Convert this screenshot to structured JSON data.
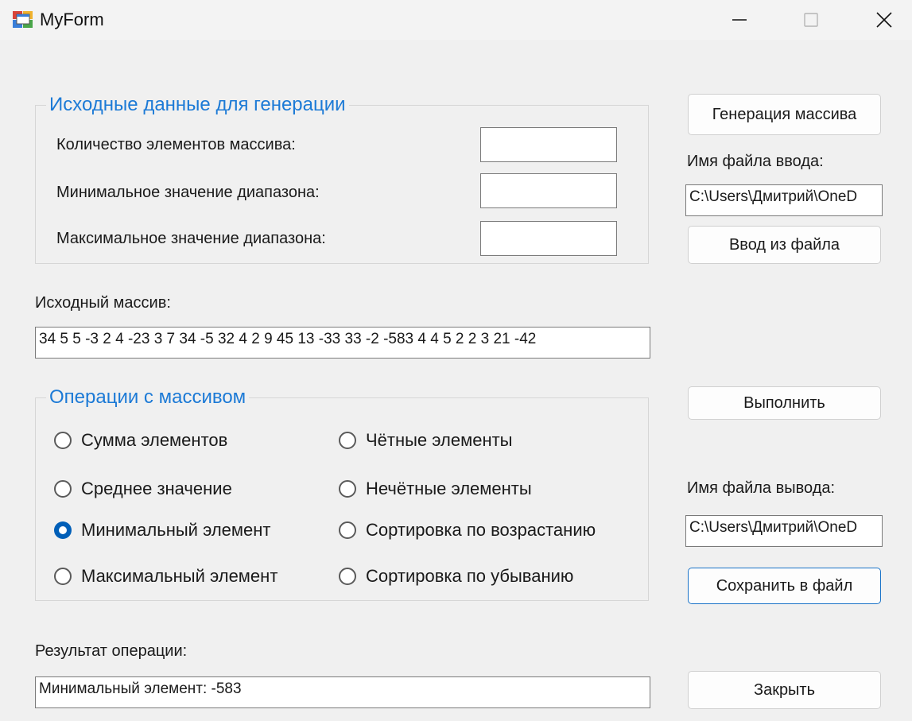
{
  "window": {
    "title": "MyForm"
  },
  "generation_group": {
    "title": "Исходные данные для генерации",
    "count_label": "Количество элементов массива:",
    "count_value": "",
    "min_label": "Минимальное значение диапазона:",
    "min_value": "",
    "max_label": "Максимальное значение диапазона:",
    "max_value": ""
  },
  "buttons": {
    "generate": "Генерация массива",
    "load_from_file": "Ввод из файла",
    "execute": "Выполнить",
    "save_to_file": "Сохранить в файл",
    "close": "Закрыть"
  },
  "input_file": {
    "label": "Имя файла ввода:",
    "value": "C:\\Users\\Дмитрий\\OneD"
  },
  "output_file": {
    "label": "Имя файла вывода:",
    "value": "C:\\Users\\Дмитрий\\OneD"
  },
  "source_array": {
    "label": "Исходный массив:",
    "value": "34 5 5 -3 2 4 -23 3 7 34 -5 32 4 2 9 45 13 -33 33 -2 -583 4 4 5 2 2 3 21 -42"
  },
  "operations_group": {
    "title": "Операции с массивом",
    "options": [
      {
        "label": "Сумма элементов",
        "checked": false
      },
      {
        "label": "Среднее значение",
        "checked": false
      },
      {
        "label": "Минимальный элемент",
        "checked": true
      },
      {
        "label": "Максимальный элемент",
        "checked": false
      },
      {
        "label": "Чётные элементы",
        "checked": false
      },
      {
        "label": "Нечётные элементы",
        "checked": false
      },
      {
        "label": "Сортировка по возрастанию",
        "checked": false
      },
      {
        "label": "Сортировка по убыванию",
        "checked": false
      }
    ]
  },
  "result": {
    "label": "Результат операции:",
    "value": "Минимальный элемент: -583"
  },
  "colors": {
    "accent": "#1c7ad6",
    "radio_checked": "#005fb8",
    "focus_border": "#1a73c8"
  }
}
